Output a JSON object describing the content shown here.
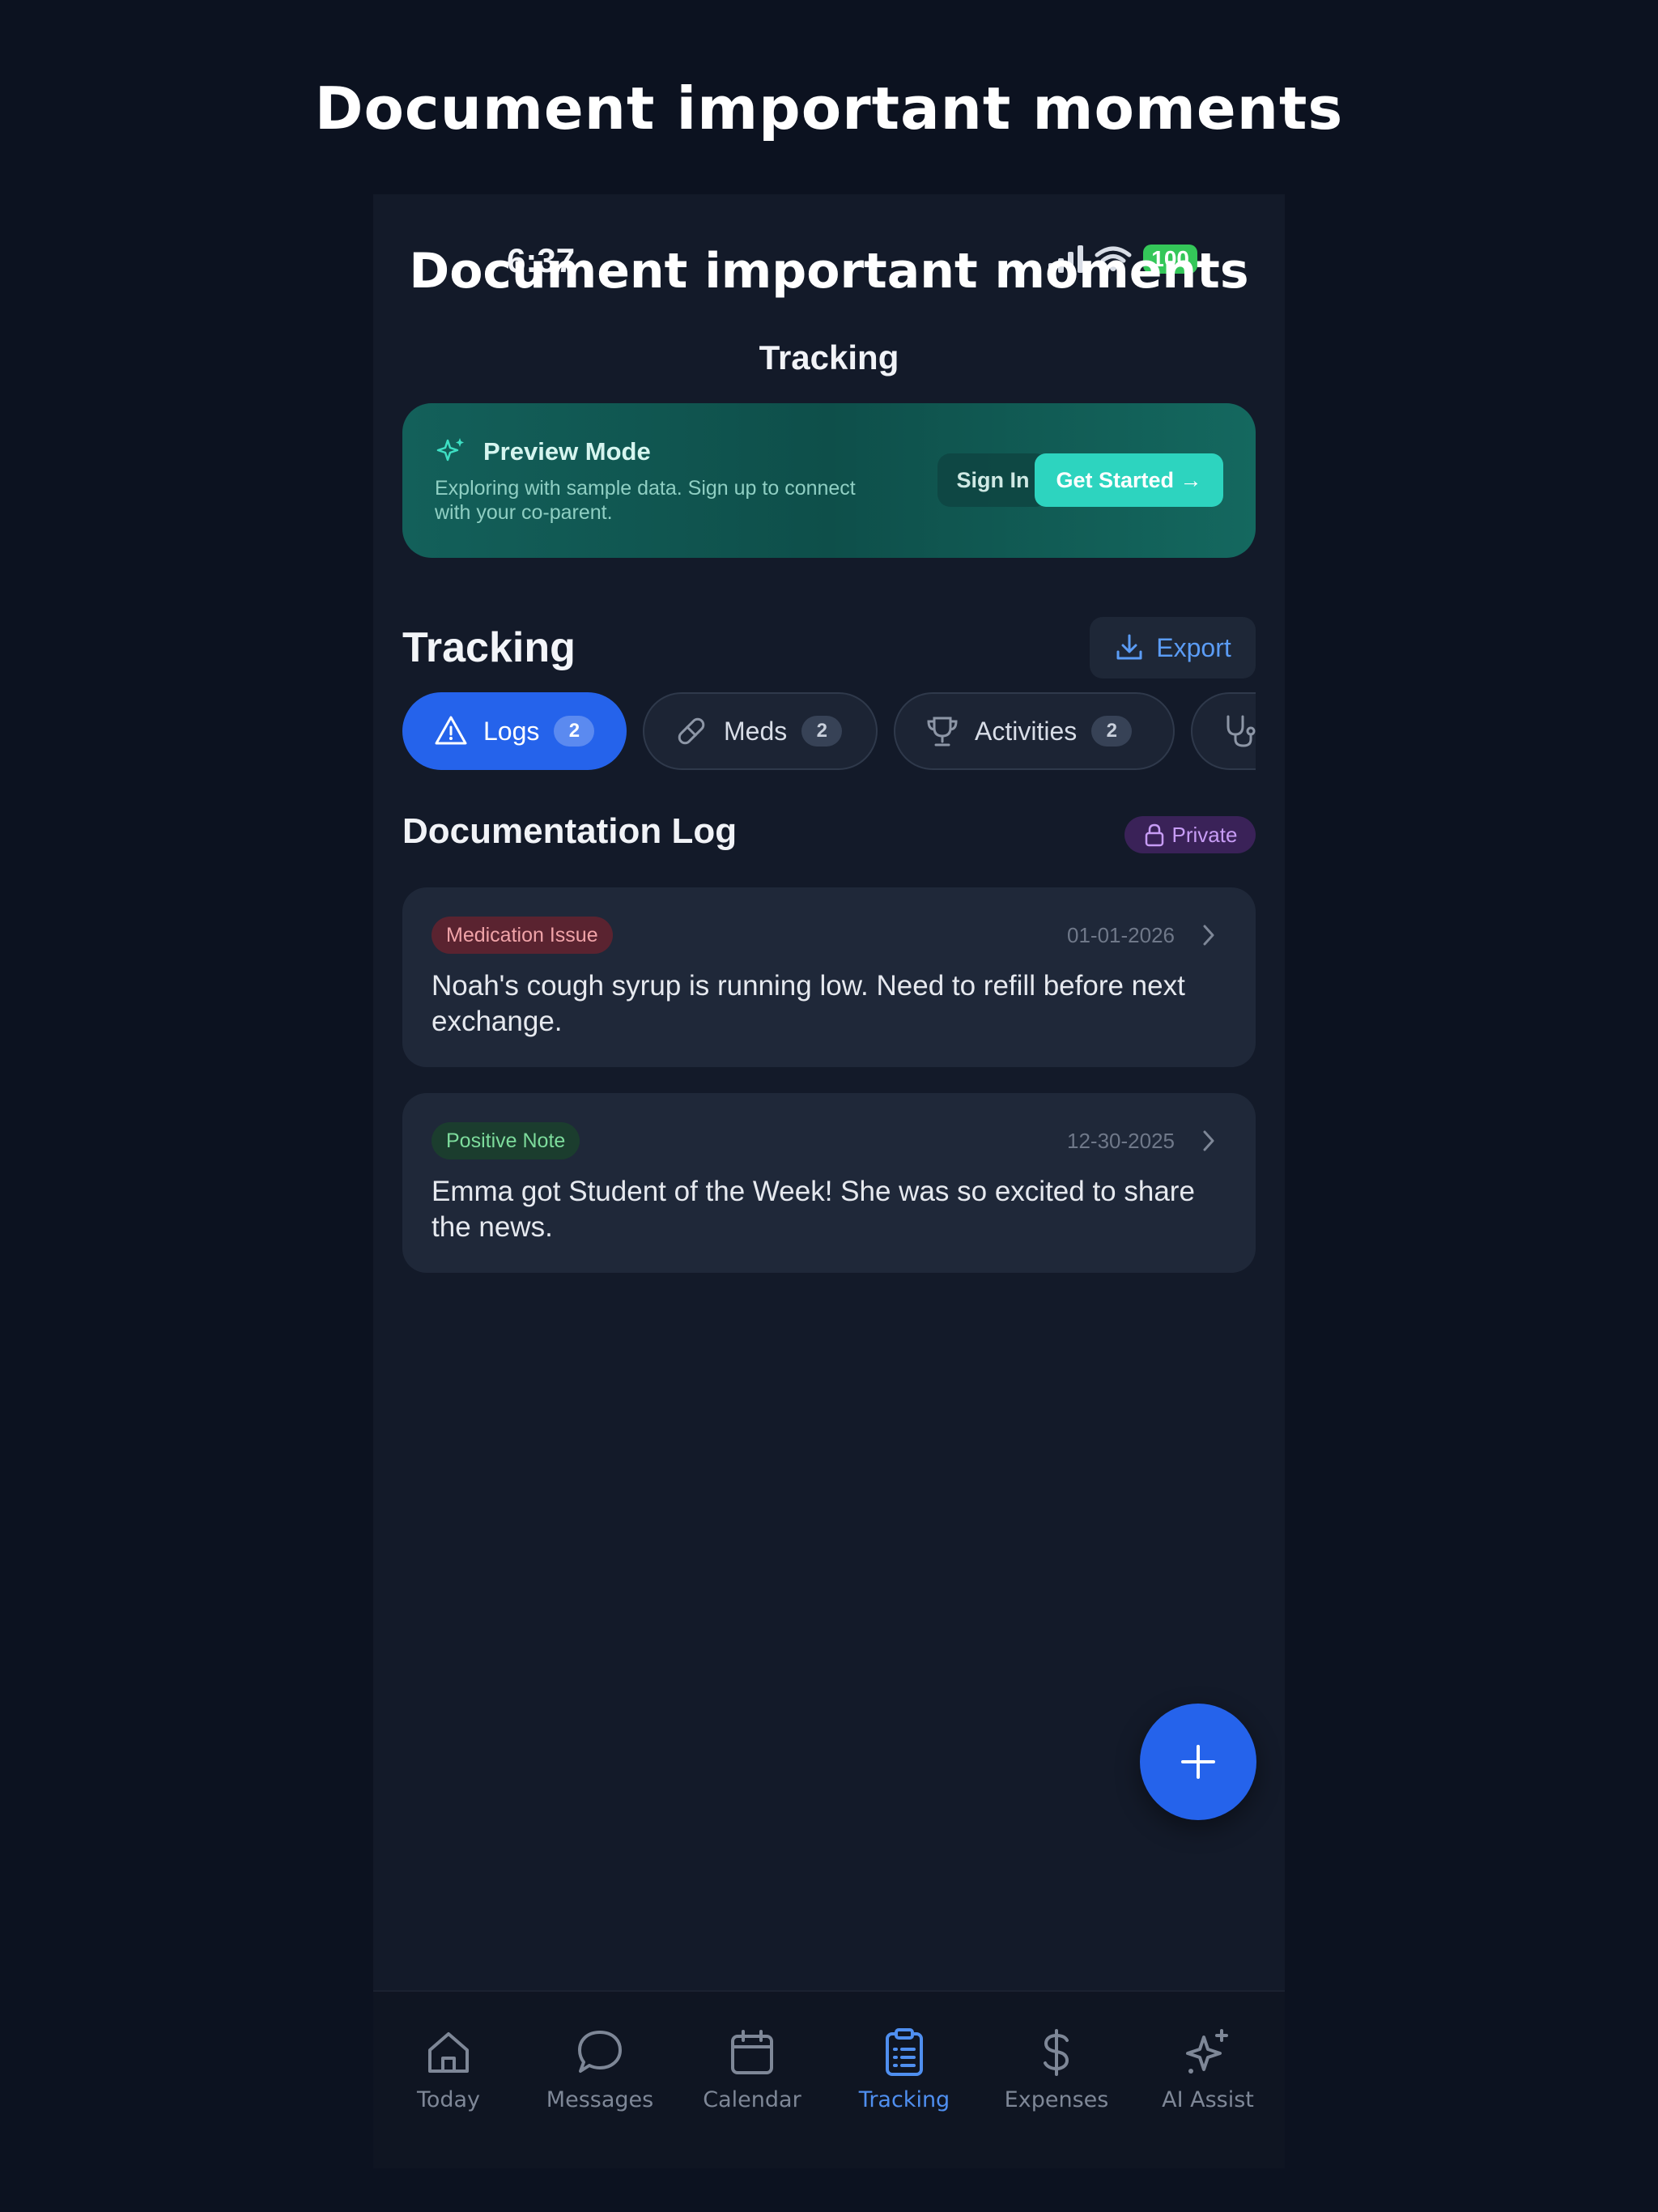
{
  "promo": {
    "title": "Document important moments"
  },
  "status_bar": {
    "time": "6:37",
    "battery": "100"
  },
  "overlay_title": "Document important moments",
  "nav": {
    "title": "Tracking"
  },
  "banner": {
    "title": "Preview Mode",
    "description": "Exploring with sample data. Sign up to connect with your co-parent.",
    "sign_in_label": "Sign In",
    "get_started_label": "Get Started →"
  },
  "section": {
    "title": "Tracking",
    "export_label": "Export"
  },
  "filters": [
    {
      "label": "Logs",
      "count": "2",
      "icon": "warning-triangle-icon",
      "active": true
    },
    {
      "label": "Meds",
      "count": "2",
      "icon": "pill-icon",
      "active": false
    },
    {
      "label": "Activities",
      "count": "2",
      "icon": "trophy-icon",
      "active": false
    },
    {
      "label": "",
      "count": "",
      "icon": "stethoscope-icon",
      "active": false
    }
  ],
  "log": {
    "title": "Documentation Log",
    "private_label": "Private",
    "entries": [
      {
        "tag": "Medication Issue",
        "tag_color": "#f0a3a8",
        "date": "01-01-2026",
        "text": "Noah's cough syrup is running low. Need to refill before next exchange."
      },
      {
        "tag": "Positive Note",
        "tag_color": "#7ddc9c",
        "date": "12-30-2025",
        "text": "Emma got Student of the Week! She was so excited to share the news."
      }
    ]
  },
  "tabbar": {
    "items": [
      {
        "label": "Today",
        "icon": "home-icon",
        "active": false
      },
      {
        "label": "Messages",
        "icon": "chat-bubble-icon",
        "active": false
      },
      {
        "label": "Calendar",
        "icon": "calendar-icon",
        "active": false
      },
      {
        "label": "Tracking",
        "icon": "clipboard-icon",
        "active": true
      },
      {
        "label": "Expenses",
        "icon": "dollar-icon",
        "active": false
      },
      {
        "label": "AI Assist",
        "icon": "sparkle-icon",
        "active": false
      }
    ]
  },
  "colors": {
    "accent": "#2563eb",
    "teal": "#2dd4bf",
    "background": "#131a29",
    "active_tab": "#4f8ff0"
  }
}
